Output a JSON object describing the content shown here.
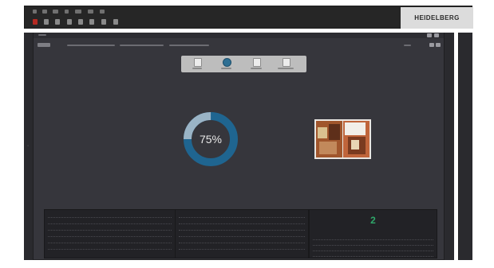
{
  "app": {
    "brand": "HEIDELBERG"
  },
  "menu": {
    "items": [
      "",
      "",
      "",
      "",
      "",
      "",
      ""
    ]
  },
  "toolbar": {
    "tools": [
      "stop-icon",
      "document-icon",
      "printer-icon",
      "copy-icon",
      "settings-icon",
      "grid-icon",
      "list-icon",
      "layout-icon"
    ]
  },
  "workspace": {
    "icon_bar": [
      {
        "icon": "document-icon",
        "active": false
      },
      {
        "icon": "status-icon",
        "active": true
      },
      {
        "icon": "preview-icon",
        "active": false
      },
      {
        "icon": "edit-icon",
        "active": false
      }
    ]
  },
  "progress": {
    "value_text": "75%",
    "fraction": 0.75,
    "colors": {
      "track": "#1f6590",
      "fill": "#9ab4c6"
    }
  },
  "panels": {
    "left": {
      "rows": [
        "",
        "",
        "",
        "",
        "",
        ""
      ]
    },
    "middle": {
      "rows": [
        "",
        "",
        "",
        "",
        "",
        ""
      ]
    },
    "right": {
      "count": "2",
      "rows": [
        "",
        "",
        "",
        ""
      ]
    }
  }
}
